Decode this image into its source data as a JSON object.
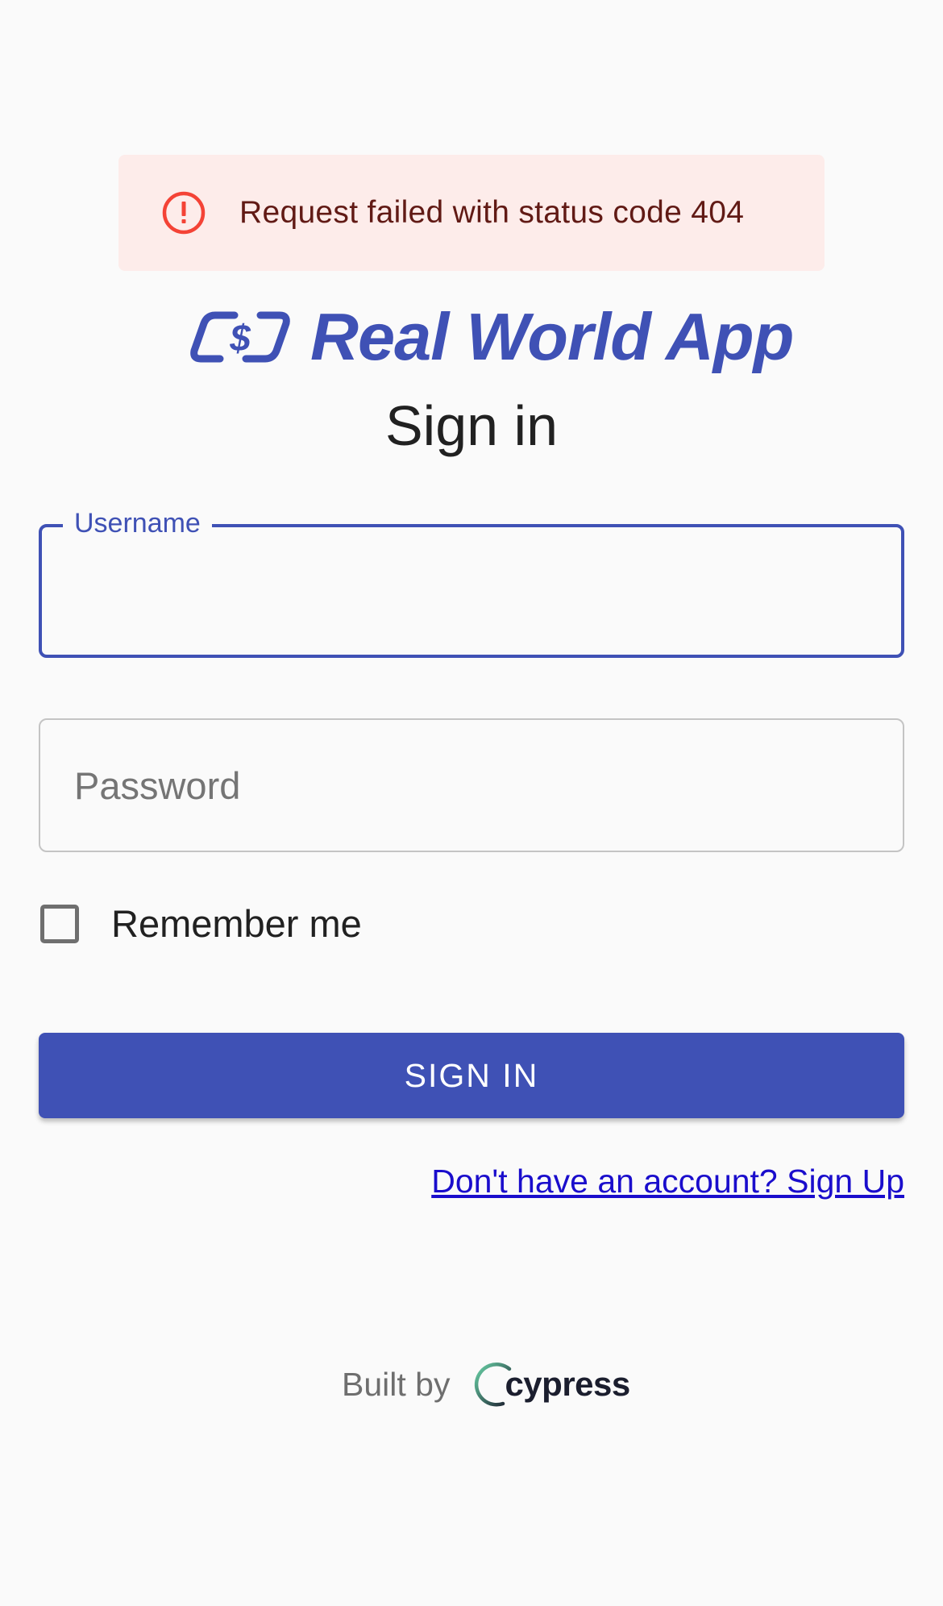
{
  "alert": {
    "message": "Request failed with status code 404",
    "icon": "error-outline-icon",
    "background_color": "#fdecea",
    "icon_color": "#f44336",
    "text_color": "#611a15"
  },
  "brand": {
    "name": "Real World App",
    "icon": "dollar-transfer-logo-icon",
    "color": "#3f51b5"
  },
  "form": {
    "title": "Sign in",
    "username": {
      "label": "Username",
      "value": ""
    },
    "password": {
      "placeholder": "Password",
      "value": ""
    },
    "remember": {
      "label": "Remember me",
      "checked": false
    },
    "submit_label": "SIGN IN",
    "signup_link": "Don't have an account? Sign Up"
  },
  "footer": {
    "built_by": "Built by",
    "brand": "cypress",
    "icon": "cypress-logo-icon"
  }
}
